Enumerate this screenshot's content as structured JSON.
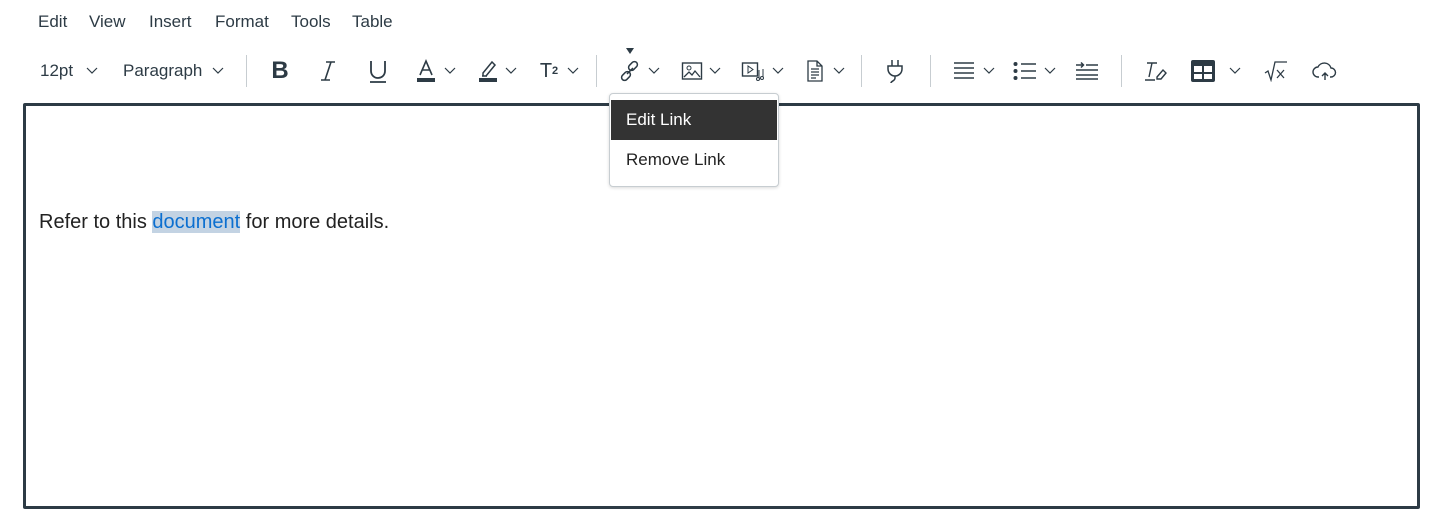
{
  "menubar": {
    "items": [
      "Edit",
      "View",
      "Insert",
      "Format",
      "Tools",
      "Table"
    ]
  },
  "toolbar": {
    "font_size": "12pt",
    "block_format": "Paragraph",
    "bold": "B",
    "italic": "I",
    "superscript": "T",
    "superscript_exp": "2",
    "icons": [
      "bold-icon",
      "italic-icon",
      "underline-icon",
      "text-color-icon",
      "highlight-icon",
      "superscript-icon",
      "link-icon",
      "image-icon",
      "media-icon",
      "document-icon",
      "plugin-icon",
      "align-icon",
      "list-icon",
      "indent-icon",
      "clear-formatting-icon",
      "table-icon",
      "math-icon",
      "cloud-upload-icon"
    ]
  },
  "link_menu": {
    "items": [
      "Edit Link",
      "Remove Link"
    ],
    "highlighted": "Edit Link"
  },
  "editor": {
    "before": "Refer to this ",
    "link_text": "document",
    "after": " for more details."
  },
  "colors": {
    "text": "#2d3b45",
    "link": "#0b6fd0",
    "selection": "#c3d3e3",
    "menu_highlight": "#333333"
  }
}
